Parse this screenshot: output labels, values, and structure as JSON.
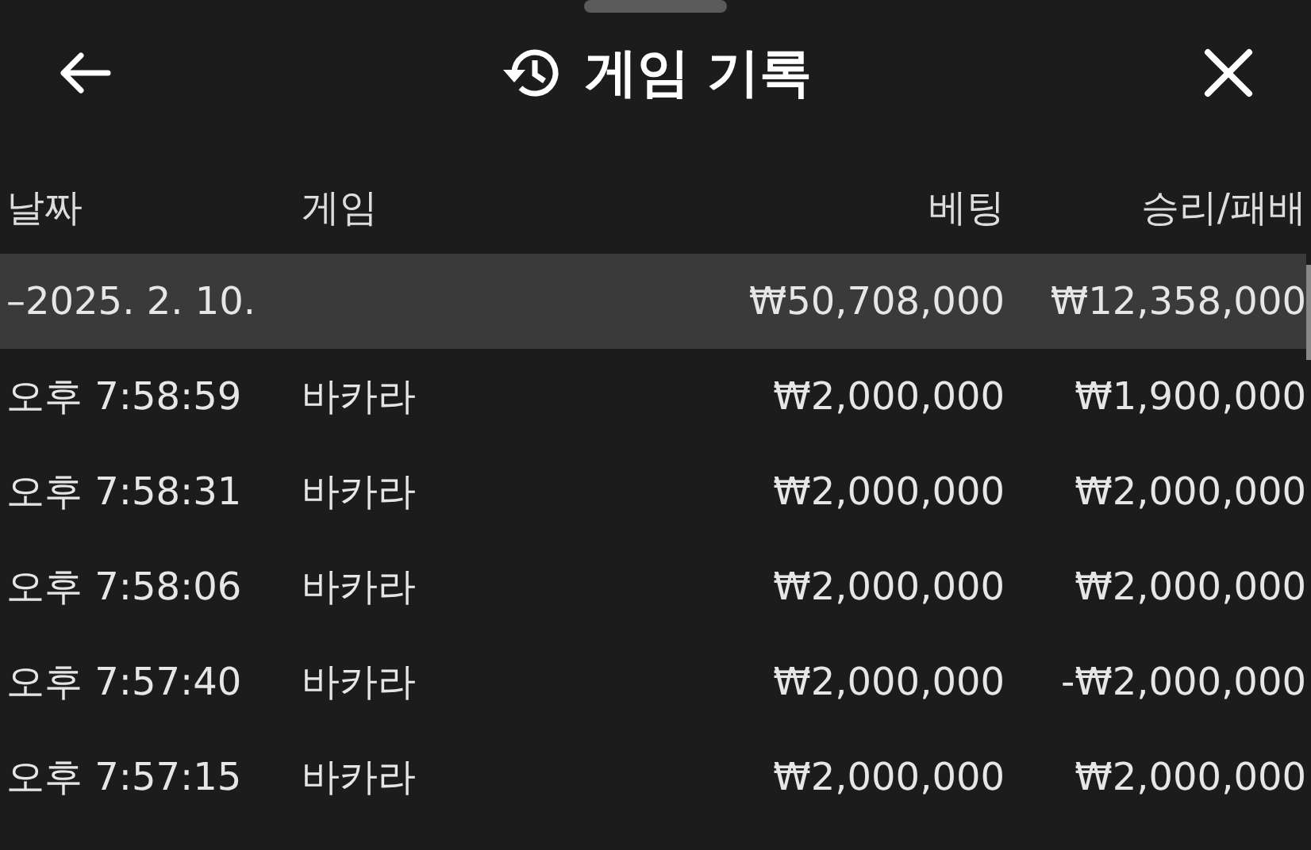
{
  "header": {
    "title": "게임 기록"
  },
  "table": {
    "columns": [
      "날짜",
      "게임",
      "베팅",
      "승리/패배"
    ],
    "group": {
      "date": "–2025. 2. 10.",
      "bet": "₩50,708,000",
      "result": "₩12,358,000",
      "selected": true
    },
    "rows": [
      {
        "time": "오후 7:58:59",
        "game": "바카라",
        "bet": "₩2,000,000",
        "result": "₩1,900,000"
      },
      {
        "time": "오후 7:58:31",
        "game": "바카라",
        "bet": "₩2,000,000",
        "result": "₩2,000,000"
      },
      {
        "time": "오후 7:58:06",
        "game": "바카라",
        "bet": "₩2,000,000",
        "result": "₩2,000,000"
      },
      {
        "time": "오후 7:57:40",
        "game": "바카라",
        "bet": "₩2,000,000",
        "result": "-₩2,000,000"
      },
      {
        "time": "오후 7:57:15",
        "game": "바카라",
        "bet": "₩2,000,000",
        "result": "₩2,000,000"
      }
    ]
  }
}
